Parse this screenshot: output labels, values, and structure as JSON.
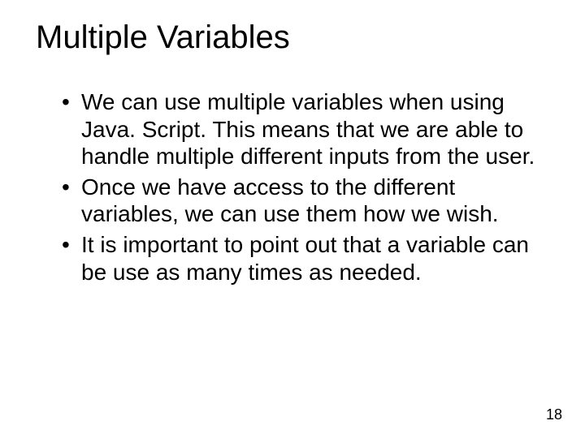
{
  "slide": {
    "title": "Multiple Variables",
    "bullets": [
      "We can use multiple variables when using Java. Script. This means that we are able to handle multiple different inputs from the user.",
      "Once we have access to the different variables, we can use them how we wish.",
      "It is important to point out that a variable can be use as many times as needed."
    ],
    "page_number": "18"
  }
}
